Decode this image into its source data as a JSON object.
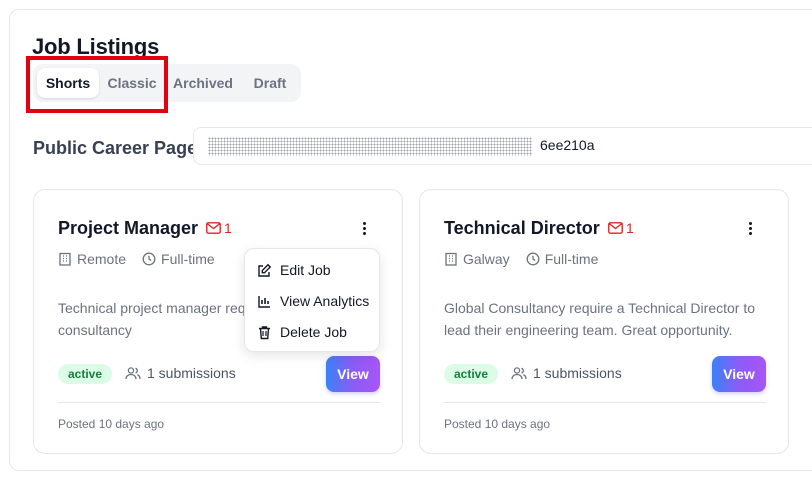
{
  "page": {
    "title": "Job Listings"
  },
  "tabs": [
    {
      "label": "Shorts",
      "active": true
    },
    {
      "label": "Classic",
      "active": false
    },
    {
      "label": "Archived",
      "active": false
    },
    {
      "label": "Draft",
      "active": false
    }
  ],
  "career_page": {
    "label": "Public Career Page:",
    "value_visible_suffix": "6ee210a"
  },
  "jobs": [
    {
      "title": "Project Manager",
      "message_count": "1",
      "location": "Remote",
      "employment_type": "Full-time",
      "description": "Technical project manager requ consultancy",
      "status": "active",
      "submissions": "1 submissions",
      "view_label": "View",
      "posted": "Posted 10 days ago"
    },
    {
      "title": "Technical Director",
      "message_count": "1",
      "location": "Galway",
      "employment_type": "Full-time",
      "description": "Global Consultancy require a Technical Director to lead their engineering team. Great opportunity.",
      "status": "active",
      "submissions": "1 submissions",
      "view_label": "View",
      "posted": "Posted 10 days ago"
    }
  ],
  "context_menu": {
    "items": [
      {
        "label": "Edit Job",
        "icon": "edit-icon"
      },
      {
        "label": "View Analytics",
        "icon": "chart-icon"
      },
      {
        "label": "Delete Job",
        "icon": "trash-icon"
      }
    ]
  },
  "colors": {
    "accent_start": "#3b82f6",
    "accent_end": "#a855f7",
    "status_bg": "#dcfce7",
    "status_text": "#15803d",
    "mail_badge": "#dc2626",
    "highlight": "#e3000f"
  }
}
